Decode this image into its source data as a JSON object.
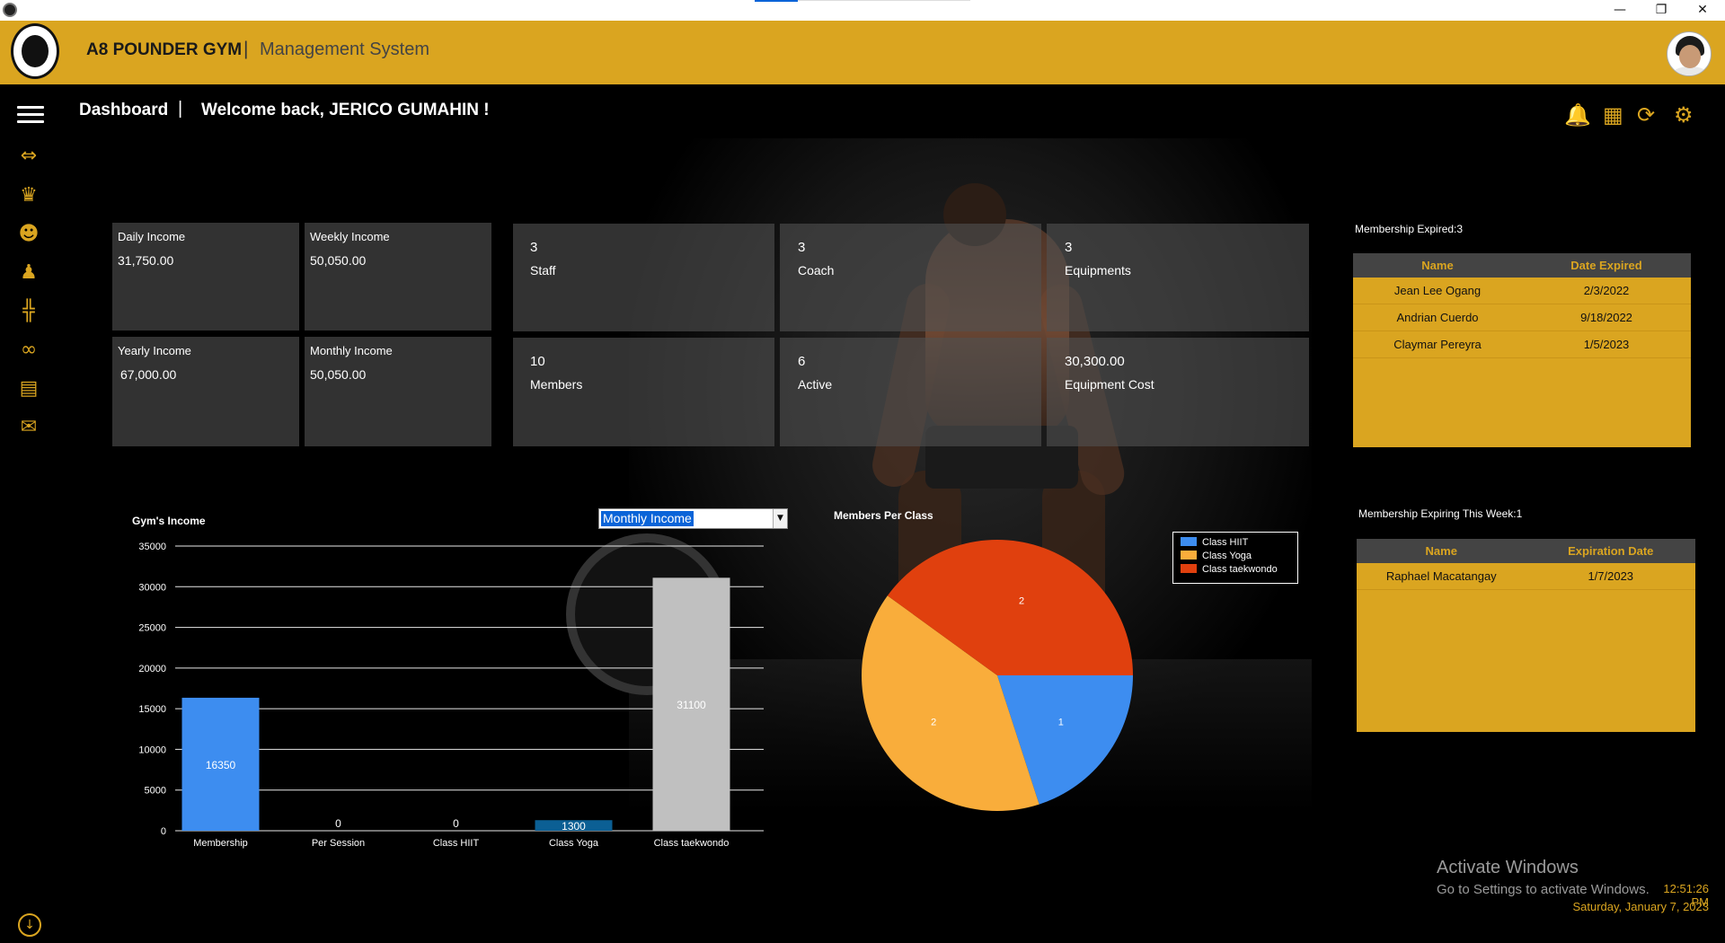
{
  "window": {
    "minimize": "—",
    "restore": "❐",
    "close": "✕"
  },
  "header": {
    "brand": "A8 POUNDER GYM",
    "separator": "|",
    "subtitle": "Management System"
  },
  "topbar": {
    "breadcrumb": "Dashboard",
    "separator": "|",
    "welcome": "Welcome back, JERICO GUMAHIN !",
    "icons": [
      "bell-icon",
      "calculator-icon",
      "refresh-icon",
      "settings-gears-icon"
    ]
  },
  "sidebar": {
    "icons": [
      "menu-icon",
      "calendar-swap-icon",
      "members-group-icon",
      "coach-icon",
      "user-icon",
      "equipment-icon",
      "link-icon",
      "report-icon",
      "mail-icon",
      "download-icon"
    ]
  },
  "income_tiles": [
    {
      "label": "Daily Income",
      "value": "31,750.00"
    },
    {
      "label": "Weekly Income",
      "value": "50,050.00"
    },
    {
      "label": "Yearly Income",
      "value": "67,000.00"
    },
    {
      "label": "Monthly Income",
      "value": "50,050.00"
    }
  ],
  "count_tiles": [
    {
      "value": "3",
      "label": "Staff"
    },
    {
      "value": "3",
      "label": "Coach"
    },
    {
      "value": "3",
      "label": "Equipments"
    },
    {
      "value": "10",
      "label": "Members"
    },
    {
      "value": "6",
      "label": "Active"
    },
    {
      "value": "30,300.00",
      "label": "Equipment Cost"
    }
  ],
  "expired": {
    "title": "Membership Expired:3",
    "headers": [
      "Name",
      "Date Expired"
    ],
    "rows": [
      [
        "Jean Lee Ogang",
        "2/3/2022"
      ],
      [
        "Andrian Cuerdo",
        "9/18/2022"
      ],
      [
        "Claymar Pereyra",
        "1/5/2023"
      ]
    ]
  },
  "expiring": {
    "title": "Membership Expiring This Week:1",
    "headers": [
      "Name",
      "Expiration Date"
    ],
    "rows": [
      [
        "Raphael Macatangay",
        "1/7/2023"
      ]
    ]
  },
  "income_chart": {
    "title": "Gym's Income",
    "selector_value": "Monthly Income"
  },
  "class_chart": {
    "title": "Members Per Class"
  },
  "chart_data": [
    {
      "type": "bar",
      "title": "Gym's Income",
      "categories": [
        "Membership",
        "Per Session",
        "Class HIIT",
        "Class Yoga",
        "Class taekwondo"
      ],
      "values": [
        16350,
        0,
        0,
        1300,
        31100
      ],
      "value_labels": [
        "16350",
        "0",
        "0",
        "1300",
        "31100"
      ],
      "colors": [
        "#3d8df0",
        "#3d8df0",
        "#3d8df0",
        "#0b5f94",
        "#c0c0c0"
      ],
      "ylim": [
        0,
        35000
      ],
      "yticks": [
        0,
        5000,
        10000,
        15000,
        20000,
        25000,
        30000,
        35000
      ],
      "ytick_labels": [
        "0",
        "5000",
        "10000",
        "15000",
        "20000",
        "25000",
        "30000",
        "35000"
      ],
      "grid": true
    },
    {
      "type": "pie",
      "title": "Members Per Class",
      "labels": [
        "Class HIIT",
        "Class Yoga",
        "Class taekwondo"
      ],
      "values": [
        1,
        2,
        2
      ],
      "value_labels": [
        "1",
        "2",
        "2"
      ],
      "colors": [
        "#3d8df0",
        "#f9ad3b",
        "#e0400e"
      ],
      "legend": "right"
    }
  ],
  "watermark": {
    "line1": "Activate Windows",
    "line2": "Go to Settings to activate Windows."
  },
  "clock": {
    "time": "12:51:26 PM",
    "date": "Saturday, January 7, 2023"
  }
}
